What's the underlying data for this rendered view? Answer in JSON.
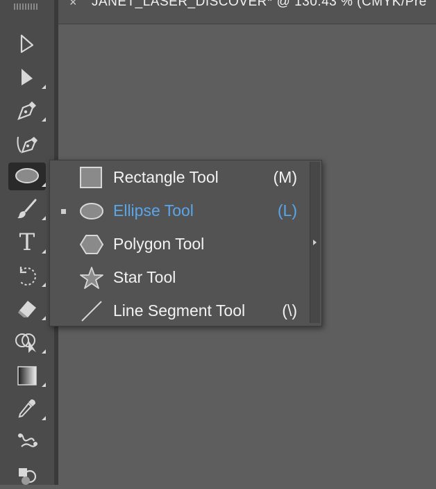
{
  "document_tab": {
    "close_glyph": "×",
    "title": "JANET_LASER_DISCOVER* @ 130.43 % (CMYK/Pre"
  },
  "toolbar": {
    "tools": [
      {
        "name": "direct-selection-tool",
        "icon": "hollow-arrow-icon"
      },
      {
        "name": "selection-tool",
        "icon": "solid-arrow-icon"
      },
      {
        "name": "pen-tool",
        "icon": "pen-nib-icon"
      },
      {
        "name": "curvature-tool",
        "icon": "curvature-pen-icon"
      },
      {
        "name": "ellipse-tool",
        "icon": "ellipse-icon",
        "active": true
      },
      {
        "name": "paintbrush-tool",
        "icon": "brush-icon"
      },
      {
        "name": "type-tool",
        "icon": "type-t-icon",
        "glyph": "T"
      },
      {
        "name": "rotate-tool",
        "icon": "rotate-icon"
      },
      {
        "name": "eraser-tool",
        "icon": "eraser-icon"
      },
      {
        "name": "shape-builder-tool",
        "icon": "shape-builder-icon"
      },
      {
        "name": "gradient-tool",
        "icon": "gradient-icon"
      },
      {
        "name": "eyedropper-tool",
        "icon": "eyedropper-icon"
      },
      {
        "name": "blend-tool",
        "icon": "blend-icon"
      },
      {
        "name": "symbol-sprayer-tool",
        "icon": "symbol-sprayer-icon"
      }
    ]
  },
  "flyout": {
    "items": [
      {
        "label": "Rectangle Tool",
        "shortcut": "(M)",
        "icon": "rectangle-icon",
        "selected": false
      },
      {
        "label": "Ellipse Tool",
        "shortcut": "(L)",
        "icon": "ellipse-icon",
        "selected": true
      },
      {
        "label": "Polygon Tool",
        "shortcut": "",
        "icon": "hexagon-icon",
        "selected": false
      },
      {
        "label": "Star Tool",
        "shortcut": "",
        "icon": "star-icon",
        "selected": false
      },
      {
        "label": "Line Segment Tool",
        "shortcut": "(\\)",
        "icon": "line-segment-icon",
        "selected": false
      }
    ]
  },
  "colors": {
    "canvas": "#5e5e5e",
    "toolbar": "#4b4b4b",
    "selected_text": "#5aa6e8"
  }
}
